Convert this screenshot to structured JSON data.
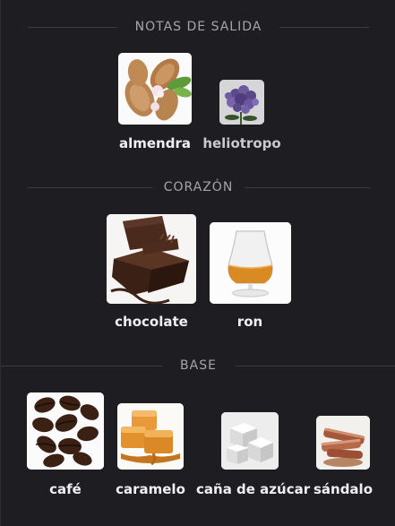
{
  "sections": {
    "top": {
      "title": "NOTAS DE SALIDA"
    },
    "heart": {
      "title": "CORAZÓN"
    },
    "base": {
      "title": "BASE"
    }
  },
  "notes": {
    "almendra": {
      "label": "almendra",
      "icon": "almond-image"
    },
    "heliotropo": {
      "label": "heliotropo",
      "icon": "heliotrope-flower-image"
    },
    "chocolate": {
      "label": "chocolate",
      "icon": "chocolate-image"
    },
    "ron": {
      "label": "ron",
      "icon": "rum-glass-image"
    },
    "cafe": {
      "label": "café",
      "icon": "coffee-beans-image"
    },
    "caramelo": {
      "label": "caramelo",
      "icon": "caramel-image"
    },
    "cana": {
      "label": "caña de azúcar",
      "icon": "sugar-cubes-image"
    },
    "sandalo": {
      "label": "sándalo",
      "icon": "sandalwood-image"
    }
  }
}
